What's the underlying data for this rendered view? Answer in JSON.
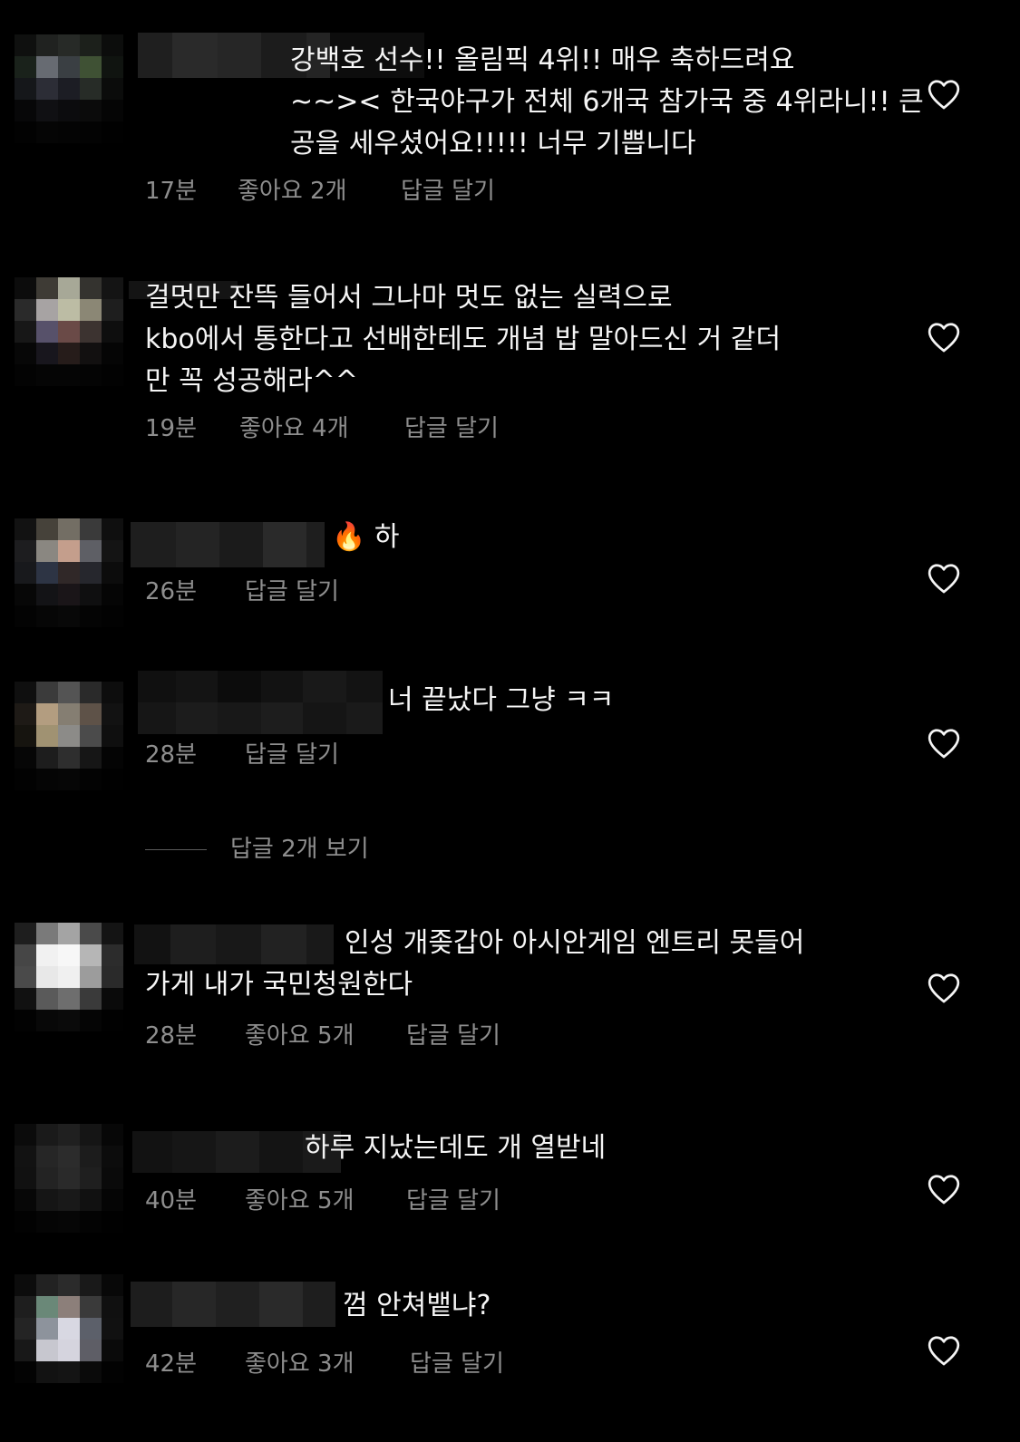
{
  "comments": [
    {
      "text": "강백호 선수!! 올림픽 4위!! 매우 축하드려요\n~~>< 한국야구가 전체 6개국 참가국 중 4위라니!! 큰\n공을 세우셨어요!!!!! 너무 기쁩니다",
      "time": "17분",
      "likes": "좋아요 2개",
      "reply": "답글 달기"
    },
    {
      "text": "걸멋만 잔뜩 들어서 그나마 멋도 없는 실력으로\nkbo에서 통한다고 선배한테도 개념 밥 말아드신 거 같더\n만 꼭 성공해라^^",
      "time": "19분",
      "likes": "좋아요 4개",
      "reply": "답글 달기"
    },
    {
      "emoji": "🔥",
      "text": "하",
      "time": "26분",
      "reply": "답글 달기"
    },
    {
      "text": "너 끝났다 그냥 ㅋㅋ",
      "time": "28분",
      "reply": "답글 달기",
      "view_replies": "답글 2개 보기"
    },
    {
      "text": "인성 개좆갑아 아시안게임 엔트리 못들어\n가게 내가 국민청원한다",
      "time": "28분",
      "likes": "좋아요 5개",
      "reply": "답글 달기"
    },
    {
      "text": "하루 지났는데도 개 열받네",
      "time": "40분",
      "likes": "좋아요 5개",
      "reply": "답글 달기"
    },
    {
      "text": "껌 안쳐뱉냐?",
      "time": "42분",
      "likes": "좋아요 3개",
      "reply": "답글 달기"
    }
  ],
  "colors": {
    "background": "#000000",
    "text": "#f5f5f5",
    "secondary": "#8e8e8e"
  },
  "icons": {
    "like": "heart-outline-icon"
  }
}
